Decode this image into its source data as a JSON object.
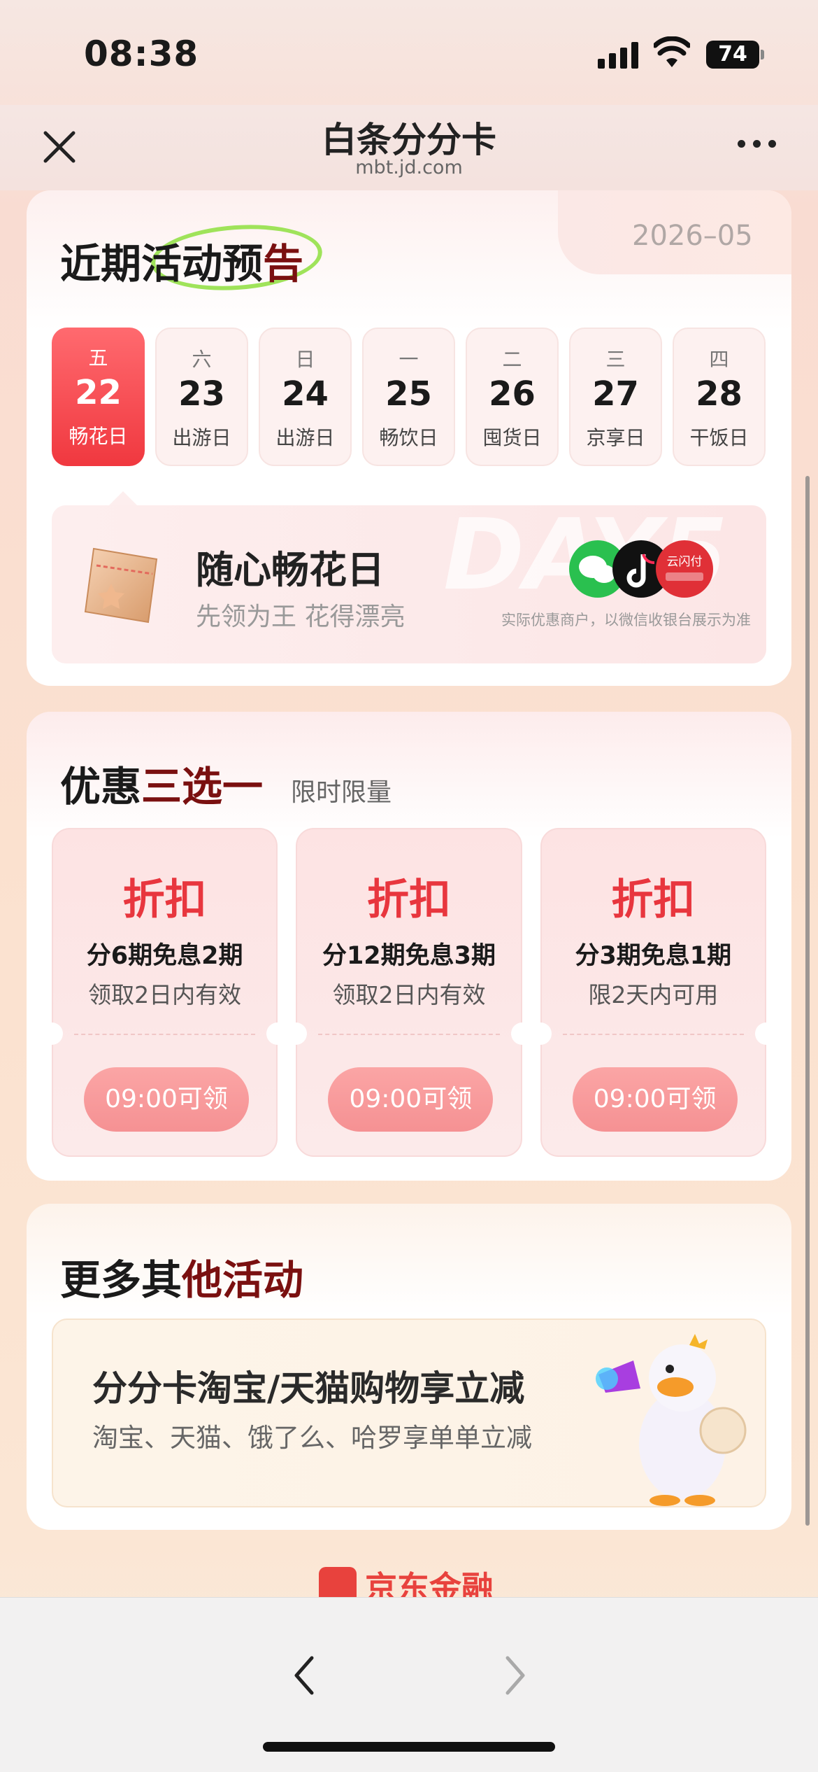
{
  "status_bar": {
    "time": "08:38",
    "battery": "74"
  },
  "nav": {
    "title": "白条分分卡",
    "url": "mbt.jd.com"
  },
  "upcoming": {
    "title_plain": "近期",
    "title_accent_1": "活动预",
    "title_accent_2": "告",
    "date": "2026–05",
    "days": [
      {
        "weekday": "五",
        "date": "22",
        "name": "畅花日",
        "active": true
      },
      {
        "weekday": "六",
        "date": "23",
        "name": "出游日",
        "active": false
      },
      {
        "weekday": "日",
        "date": "24",
        "name": "出游日",
        "active": false
      },
      {
        "weekday": "一",
        "date": "25",
        "name": "畅饮日",
        "active": false
      },
      {
        "weekday": "二",
        "date": "26",
        "name": "囤货日",
        "active": false
      },
      {
        "weekday": "三",
        "date": "27",
        "name": "京享日",
        "active": false
      },
      {
        "weekday": "四",
        "date": "28",
        "name": "干饭日",
        "active": false
      }
    ],
    "feature": {
      "watermark": "DAY5",
      "title": "随心畅花日",
      "subtitle": "先领为王 花得漂亮",
      "merchant_note": "实际优惠商户，以微信收银台展示为准",
      "union_label": "云闪付"
    }
  },
  "offers": {
    "title_plain": "优惠",
    "title_accent": "三选一",
    "subtitle": "限时限量",
    "coupons": [
      {
        "type": "折扣",
        "desc": "分6期免息2期",
        "validity": "领取2日内有效",
        "button": "09:00可领"
      },
      {
        "type": "折扣",
        "desc": "分12期免息3期",
        "validity": "领取2日内有效",
        "button": "09:00可领"
      },
      {
        "type": "折扣",
        "desc": "分3期免息1期",
        "validity": "限2天内可用",
        "button": "09:00可领"
      }
    ]
  },
  "more": {
    "title_plain": "更多其",
    "title_accent": "他活动",
    "promo": {
      "title": "分分卡淘宝/天猫购物享立减",
      "subtitle": "淘宝、天猫、饿了么、哈罗享单单立减"
    }
  },
  "footer": {
    "brand": "京东金融"
  },
  "colors": {
    "accent_red": "#e8363e",
    "active_day": "#f0383f",
    "highlight_circle": "#9fe35a"
  }
}
